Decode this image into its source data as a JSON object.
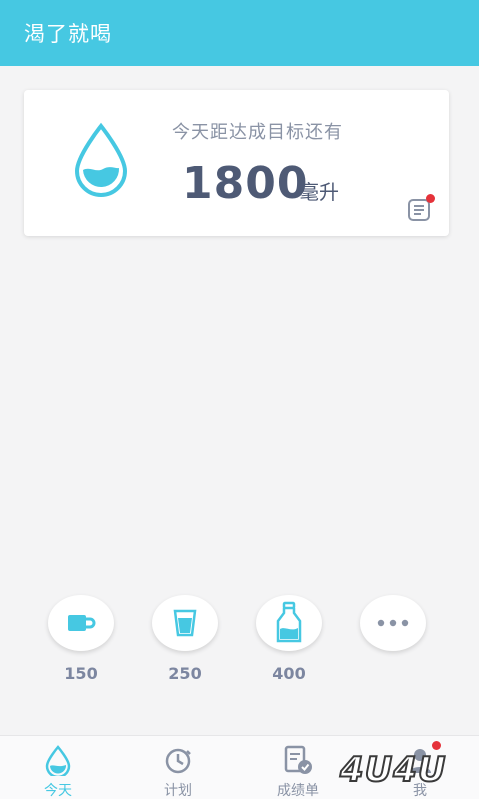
{
  "app": {
    "title": "渴了就喝"
  },
  "goal": {
    "caption": "今天距达成目标还有",
    "amount": "1800",
    "unit": "毫升",
    "icon": "water-drop-icon",
    "note_icon": "note-icon"
  },
  "cups": [
    {
      "label": "150",
      "icon": "mug-icon"
    },
    {
      "label": "250",
      "icon": "glass-icon"
    },
    {
      "label": "400",
      "icon": "bottle-icon"
    },
    {
      "label": "",
      "icon": "more-icon"
    }
  ],
  "tabs": [
    {
      "label": "今天",
      "icon": "drop-icon",
      "active": true
    },
    {
      "label": "计划",
      "icon": "clock-icon",
      "active": false
    },
    {
      "label": "成绩单",
      "icon": "report-icon",
      "active": false
    },
    {
      "label": "我",
      "icon": "user-icon",
      "active": false
    }
  ],
  "watermark": "4U4U",
  "colors": {
    "accent": "#46c8e2",
    "text_dark": "#4e5a75",
    "text_muted": "#8a93a5",
    "badge": "#e5323a"
  }
}
